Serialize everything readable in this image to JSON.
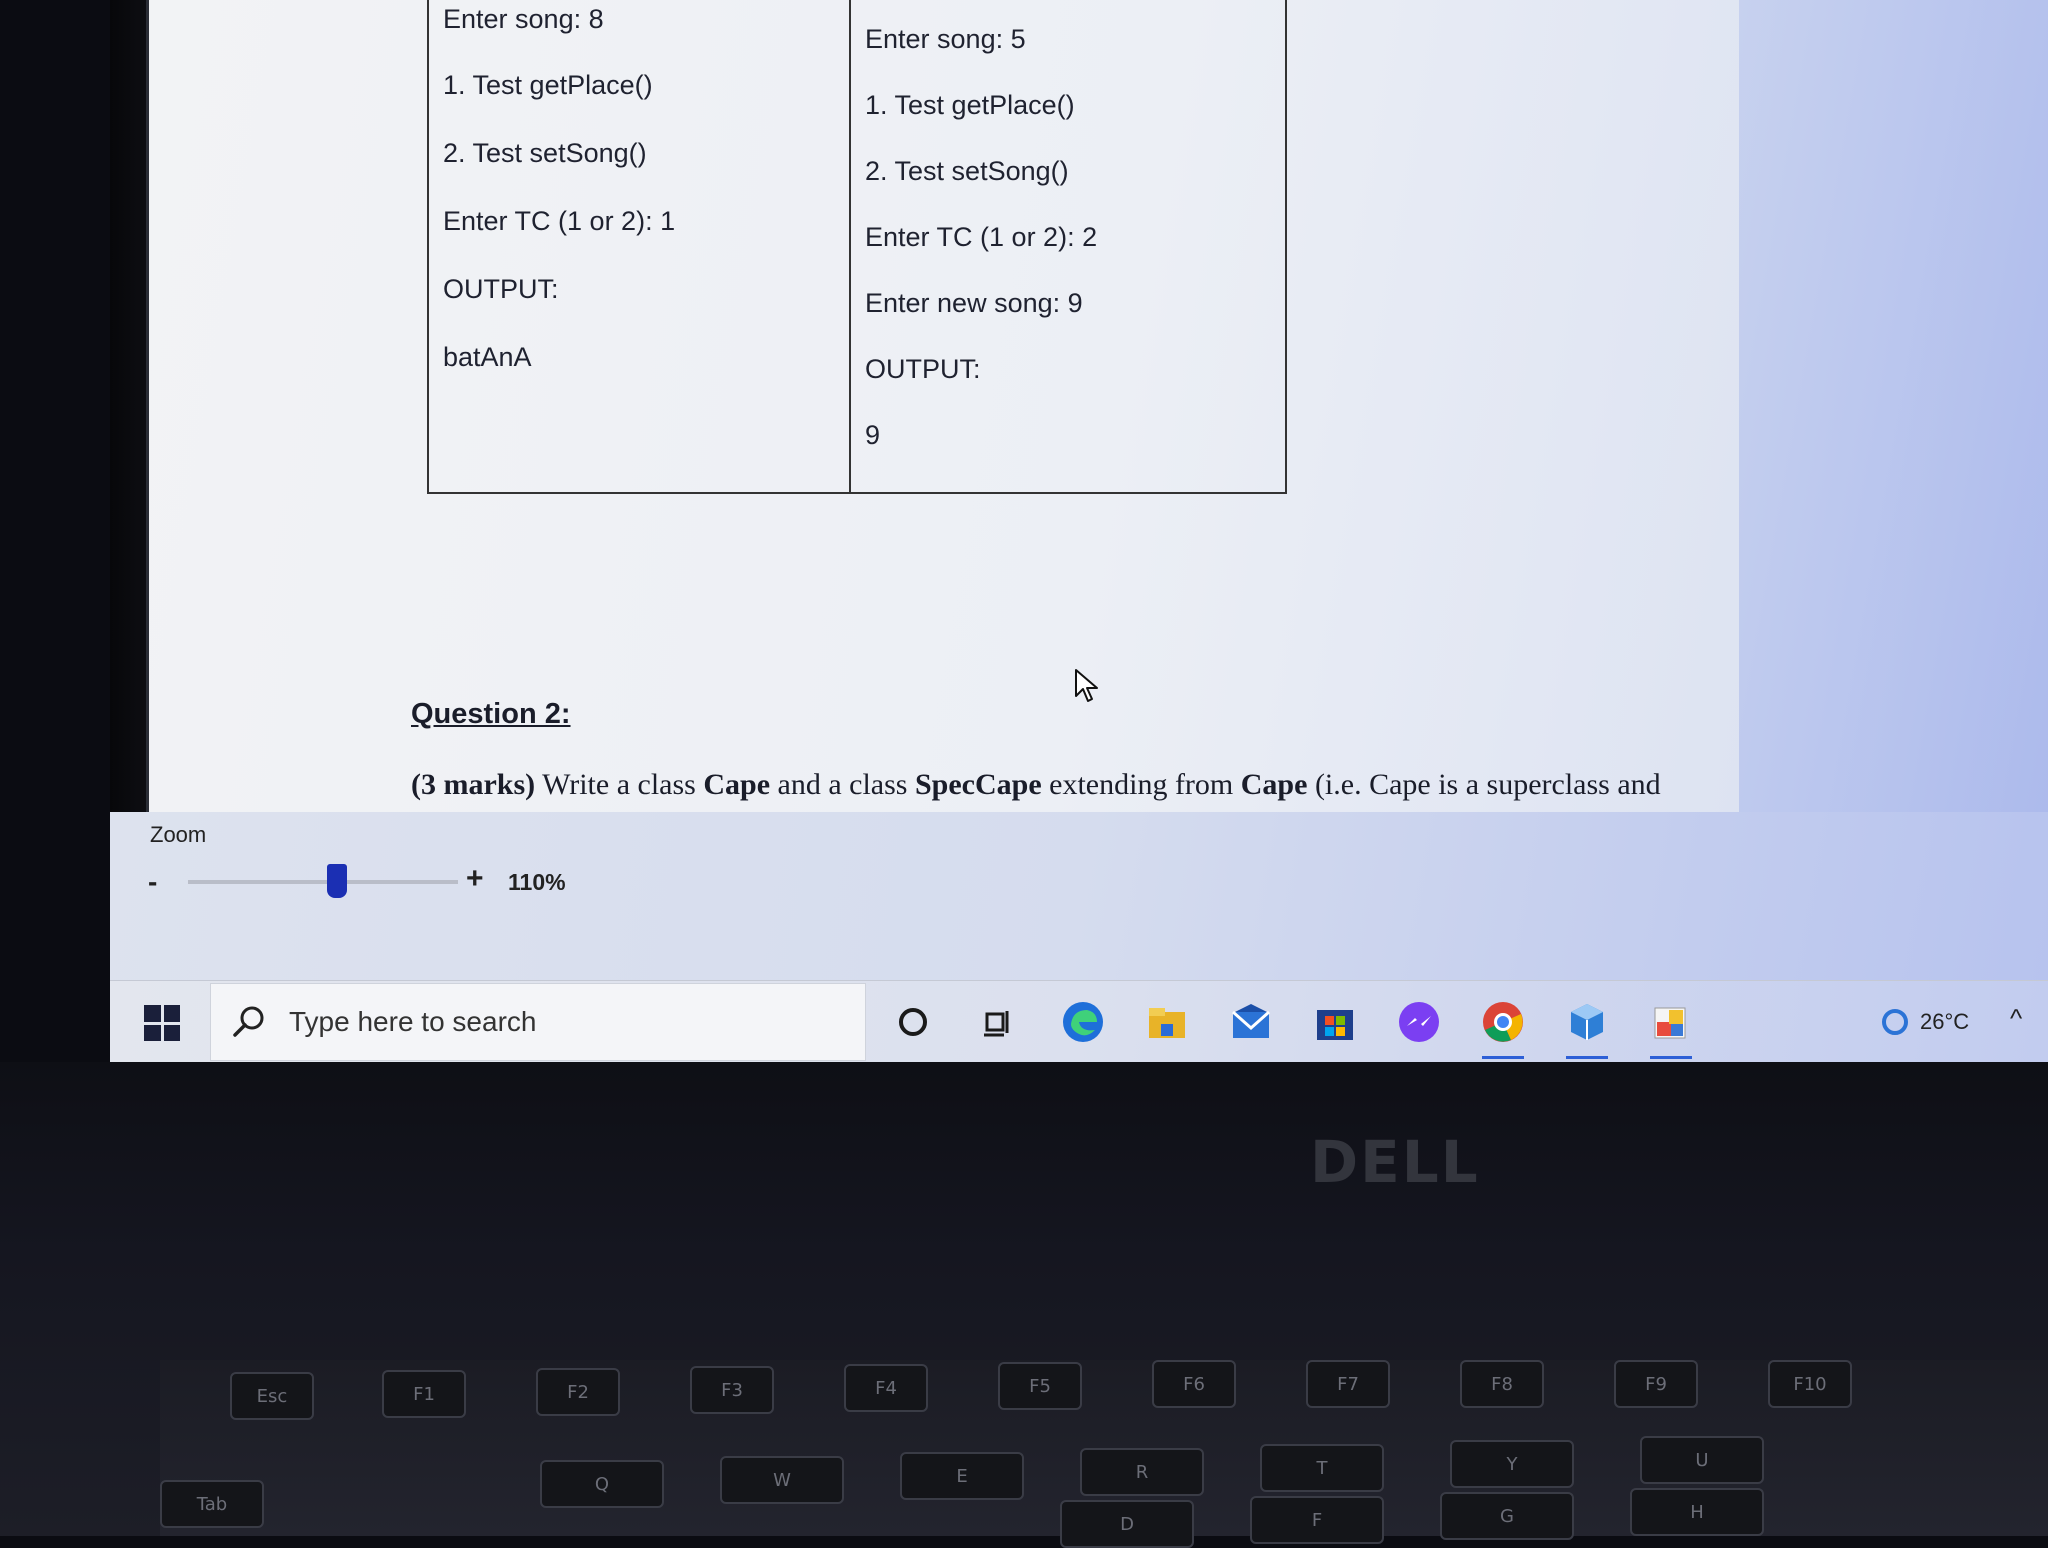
{
  "document": {
    "test_table": {
      "left_column": [
        "Enter song: 8",
        "1. Test getPlace()",
        "2. Test setSong()",
        "Enter TC (1 or 2): 1",
        "OUTPUT:",
        "batAnA"
      ],
      "right_column": [
        "Enter song: 5",
        "1. Test getPlace()",
        "2. Test setSong()",
        "Enter TC (1 or 2): 2",
        "Enter new song: 9",
        "OUTPUT:",
        "9"
      ]
    },
    "question": {
      "title": "Question 2:",
      "marks": "(3 marks)",
      "text_1": " Write a class ",
      "class_1": "Cape",
      "text_2": " and a class ",
      "class_2": "SpecCape",
      "text_3": " extending from ",
      "class_3": "Cape",
      "text_4": " (i.e. Cape is a superclass and"
    }
  },
  "zoom": {
    "label": "Zoom",
    "minus": "-",
    "plus": "+",
    "value": "110%",
    "slider_fraction": 0.55
  },
  "taskbar": {
    "search_placeholder": "Type here to search",
    "apps": [
      {
        "name": "cortana-icon",
        "color": "#1a1a1a"
      },
      {
        "name": "task-view-icon",
        "color": "#1a1a1a"
      },
      {
        "name": "edge-icon",
        "color": "#1e6fd9"
      },
      {
        "name": "file-explorer-icon",
        "color": "#e8b328"
      },
      {
        "name": "mail-icon",
        "color": "#2b73d6"
      },
      {
        "name": "store-icon",
        "color": "#1e3f8c"
      },
      {
        "name": "messenger-icon",
        "color": "#7b3ff2"
      },
      {
        "name": "chrome-icon",
        "color": "#db4437"
      },
      {
        "name": "3d-viewer-icon",
        "color": "#2e7fd6"
      },
      {
        "name": "paint-icon",
        "color": "#e84c3d"
      }
    ],
    "weather": {
      "temp": "26°C"
    },
    "tray_chevron": "^"
  },
  "laptop": {
    "brand": "DELL",
    "keys": [
      "Esc",
      "F1",
      "F2",
      "F3",
      "F4",
      "F5",
      "F6",
      "F7",
      "F8",
      "F9",
      "F10",
      "Tab",
      "Q",
      "W",
      "E",
      "R",
      "T",
      "Y",
      "U",
      "D",
      "F",
      "G",
      "H"
    ]
  }
}
